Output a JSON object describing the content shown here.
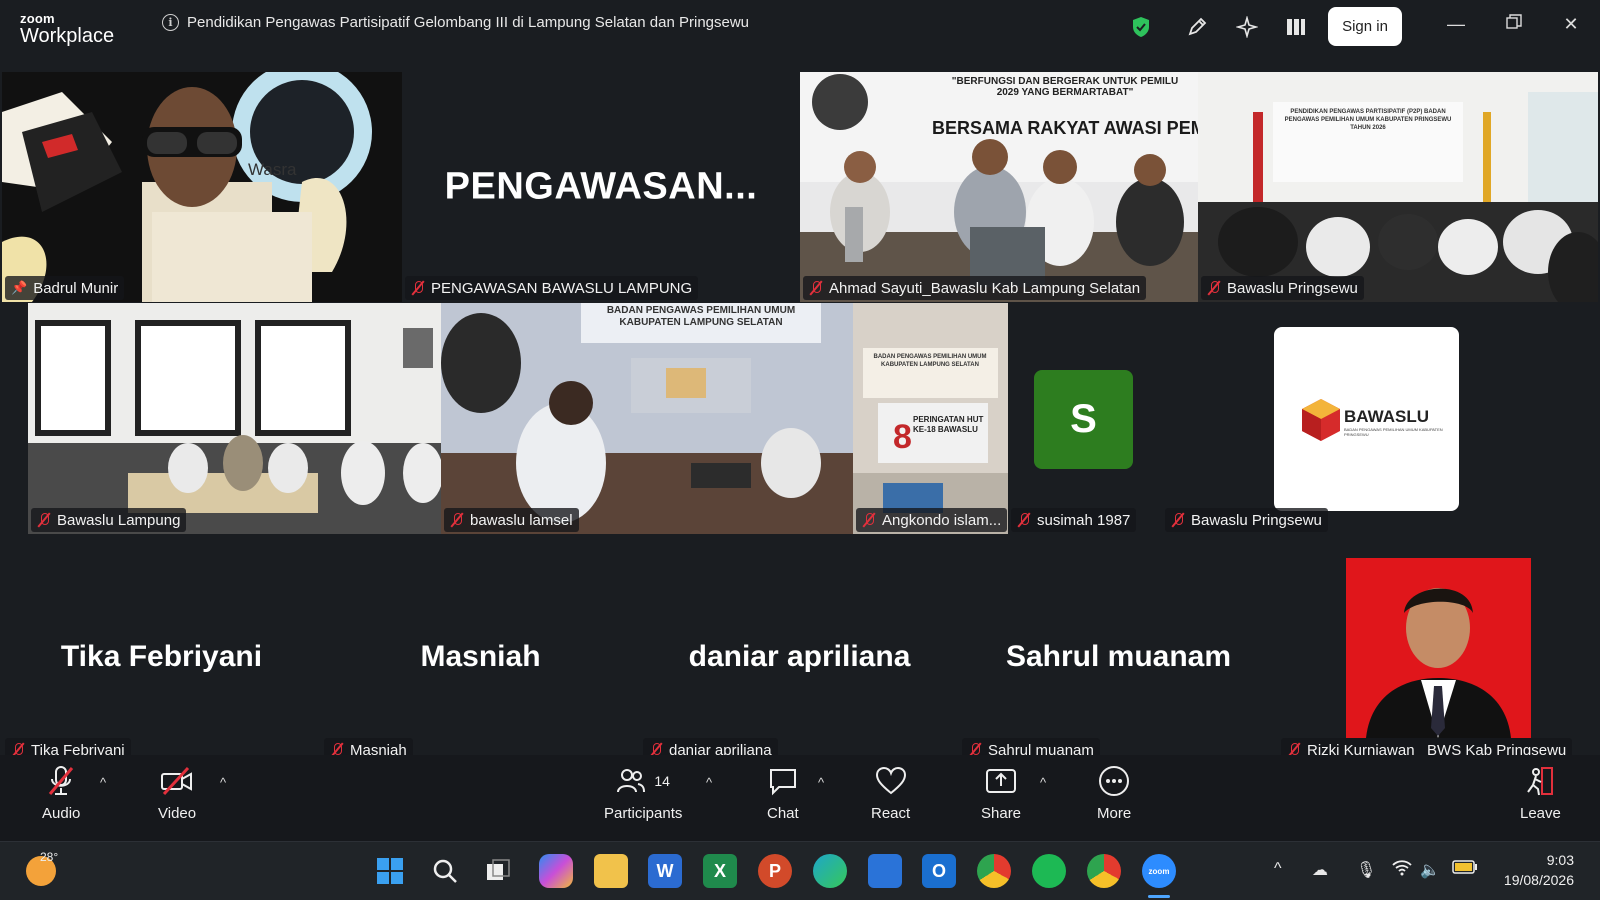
{
  "app": {
    "logo_small": "zoom",
    "logo_big": "Workplace",
    "meeting_title": "Pendidikan Pengawas Partisipatif Gelombang III di Lampung Selatan dan Pringsewu",
    "sign_in": "Sign in",
    "colors": {
      "background": "#1a1d21",
      "active_speaker": "#2fd67b",
      "muted": "#e2303c",
      "shield": "#2ec25c"
    }
  },
  "tiles": [
    {
      "name": "Badrul Munir",
      "pinned": true,
      "active": true,
      "video": "wasra",
      "overlay_text": "Wasra"
    },
    {
      "name": "PENGAWASAN BAWASLU LAMPUNG",
      "big_text": "PENGAWASAN..."
    },
    {
      "name": "Ahmad Sayuti_Bawaslu Kab Lampung Selatan",
      "video": "panel",
      "banner_top": "\"BERFUNGSI DAN BERGERAK UNTUK PEMILU 2029 YANG BERMARTABAT\"",
      "banner_main": "BERSAMA RAKYAT AWASI PEMILU"
    },
    {
      "name": "Bawaslu Pringsewu",
      "video": "classroom",
      "banner_text": "PENDIDIKAN PENGAWAS PARTISIPATIF (P2P) BADAN PENGAWAS PEMILIHAN UMUM KABUPATEN PRINGSEWU TAHUN 2026"
    },
    {
      "name": "Bawaslu Lampung",
      "video": "office"
    },
    {
      "name": "bawaslu lamsel",
      "video": "room",
      "banner_text": "BADAN PENGAWAS PEMILIHAN UMUM KABUPATEN LAMPUNG SELATAN"
    },
    {
      "name": "Angkondo islam...",
      "video": "poster",
      "poster_line1": "BADAN PENGAWAS PEMILIHAN UMUM KABUPATEN LAMPUNG SELATAN",
      "poster_line2": "PERINGATAN HUT KE-18 BAWASLU"
    },
    {
      "name": "susimah 1987",
      "avatar_letter": "S"
    },
    {
      "name": "Bawaslu Pringsewu",
      "logo_text": "BAWASLU",
      "logo_sub": "BADAN PENGAWAS PEMILIHAN UMUM KABUPATEN PRINGSEWU"
    },
    {
      "name": "Tika Febriyani",
      "big_text": "Tika Febriyani"
    },
    {
      "name": "Masniah",
      "big_text": "Masniah"
    },
    {
      "name": "daniar apriliana",
      "big_text": "daniar apriliana"
    },
    {
      "name": "Sahrul muanam",
      "big_text": "Sahrul muanam"
    },
    {
      "name": "Rizki Kurniawan_ BWS Kab Pringsewu",
      "video": "portrait"
    }
  ],
  "toolbar": {
    "audio": "Audio",
    "video": "Video",
    "participants": "Participants",
    "participant_count": "14",
    "chat": "Chat",
    "react": "React",
    "share": "Share",
    "more": "More",
    "leave": "Leave"
  },
  "taskbar": {
    "weather": "28°",
    "time": "9:03",
    "date": "19/08/2026",
    "apps": [
      "start-icon",
      "search-icon",
      "task-view-icon",
      "copilot-icon",
      "file-explorer-icon",
      "word-icon",
      "excel-icon",
      "powerpoint-icon",
      "edge-icon",
      "store-icon",
      "outlook-icon",
      "chrome-icon",
      "spotify-icon",
      "chrome-profile-icon",
      "zoom-icon"
    ],
    "zoom_label": "zoom"
  }
}
